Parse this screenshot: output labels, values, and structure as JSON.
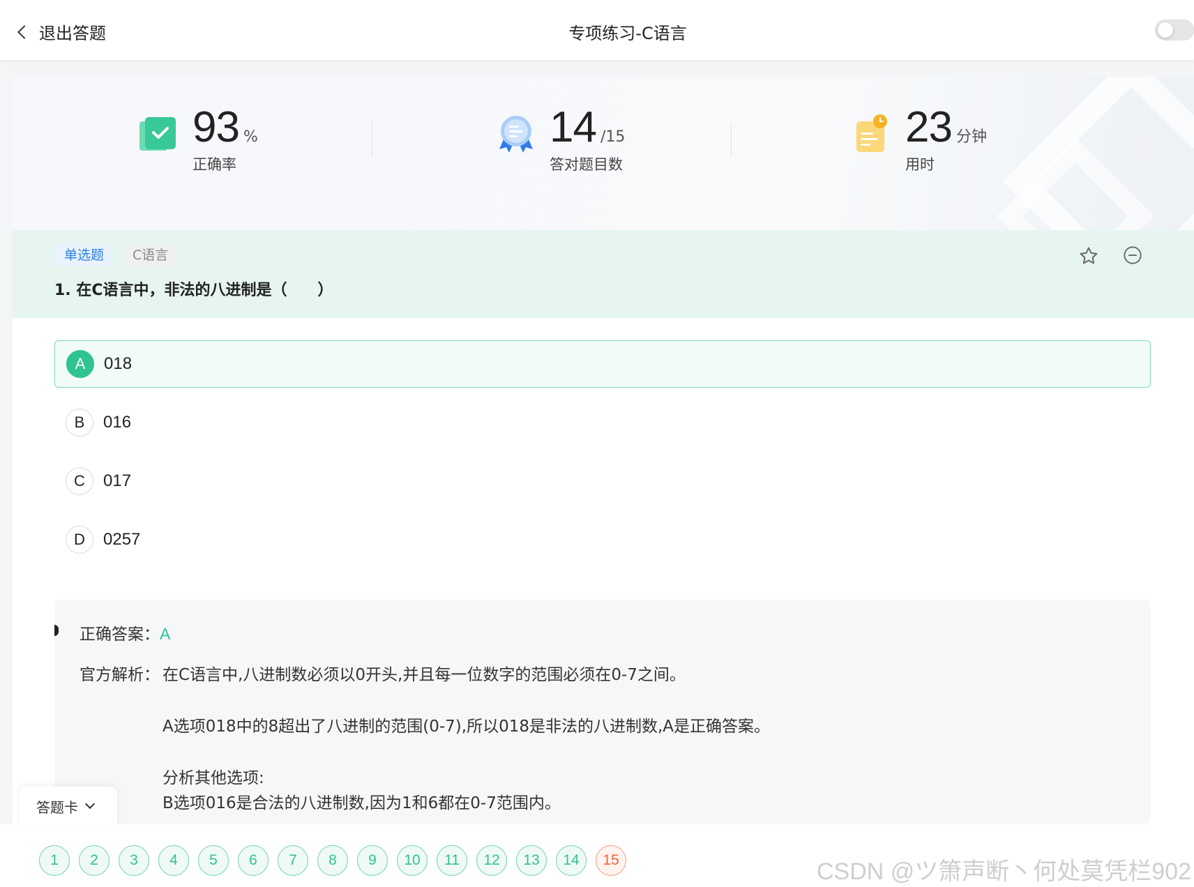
{
  "header": {
    "back_label": "退出答题",
    "title": "专项练习-C语言"
  },
  "stats": {
    "accuracy": {
      "value": "93",
      "unit": "%",
      "label": "正确率"
    },
    "correct": {
      "value": "14",
      "unit": "/15",
      "label": "答对题目数"
    },
    "time": {
      "value": "23",
      "unit": "分钟",
      "label": "用时"
    }
  },
  "question": {
    "type_tag": "单选题",
    "subject_tag": "C语言",
    "text": "1. 在C语言中，非法的八进制是（　　）",
    "options": [
      {
        "key": "A",
        "text": "018"
      },
      {
        "key": "B",
        "text": "016"
      },
      {
        "key": "C",
        "text": "017"
      },
      {
        "key": "D",
        "text": "0257"
      }
    ],
    "selected": "A"
  },
  "analysis": {
    "answer_label": "正确答案：",
    "answer": "A",
    "explain_label": "官方解析：",
    "lines": [
      "在C语言中,八进制数必须以0开头,并且每一位数字的范围必须在0-7之间。",
      "A选项018中的8超出了八进制的范围(0-7),所以018是非法的八进制数,A是正确答案。",
      "分析其他选项:",
      "B选项016是合法的八进制数,因为1和6都在0-7范围内。"
    ]
  },
  "answer_card": {
    "label": "答题卡",
    "numbers": [
      "1",
      "2",
      "3",
      "4",
      "5",
      "6",
      "7",
      "8",
      "9",
      "10",
      "11",
      "12",
      "13",
      "14",
      "15"
    ],
    "wrong": [
      "15"
    ]
  },
  "watermark": "CSDN @ツ箫声断丶何处莫凭栏902",
  "colors": {
    "accent": "#2ec391",
    "wrong": "#f0652f",
    "tag_blue": "#2b7fe3"
  }
}
